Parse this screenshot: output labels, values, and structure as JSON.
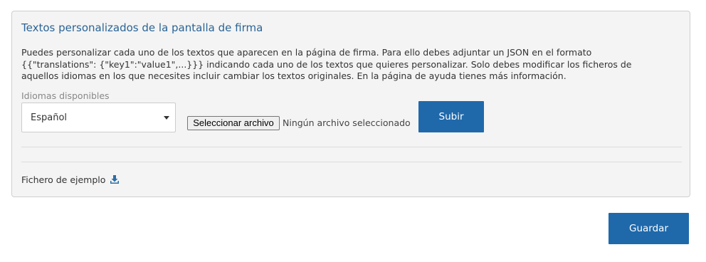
{
  "panel": {
    "title": "Textos personalizados de la pantalla de firma",
    "description": "Puedes personalizar cada uno de los textos que aparecen en la página de firma. Para ello debes adjuntar un JSON en el formato {{\"translations\": {\"key1\":\"value1\",...}}} indicando cada uno de los textos que quieres personalizar. Solo debes modificar los ficheros de aquellos idiomas en los que necesites incluir cambiar los textos originales. En la página de ayuda tienes más información.",
    "languages_label": "Idiomas disponibles",
    "language_selected": "Español",
    "file_button_label": "Seleccionar archivo",
    "file_status": "Ningún archivo seleccionado",
    "upload_label": "Subir",
    "example_file_label": "Fichero de ejemplo"
  },
  "footer": {
    "save_label": "Guardar"
  },
  "colors": {
    "accent": "#1f69ab",
    "title": "#2a6496",
    "panel_background": "#f4f4f4"
  },
  "icons": {
    "example_download": "download-icon",
    "select_caret": "caret-down-icon"
  }
}
